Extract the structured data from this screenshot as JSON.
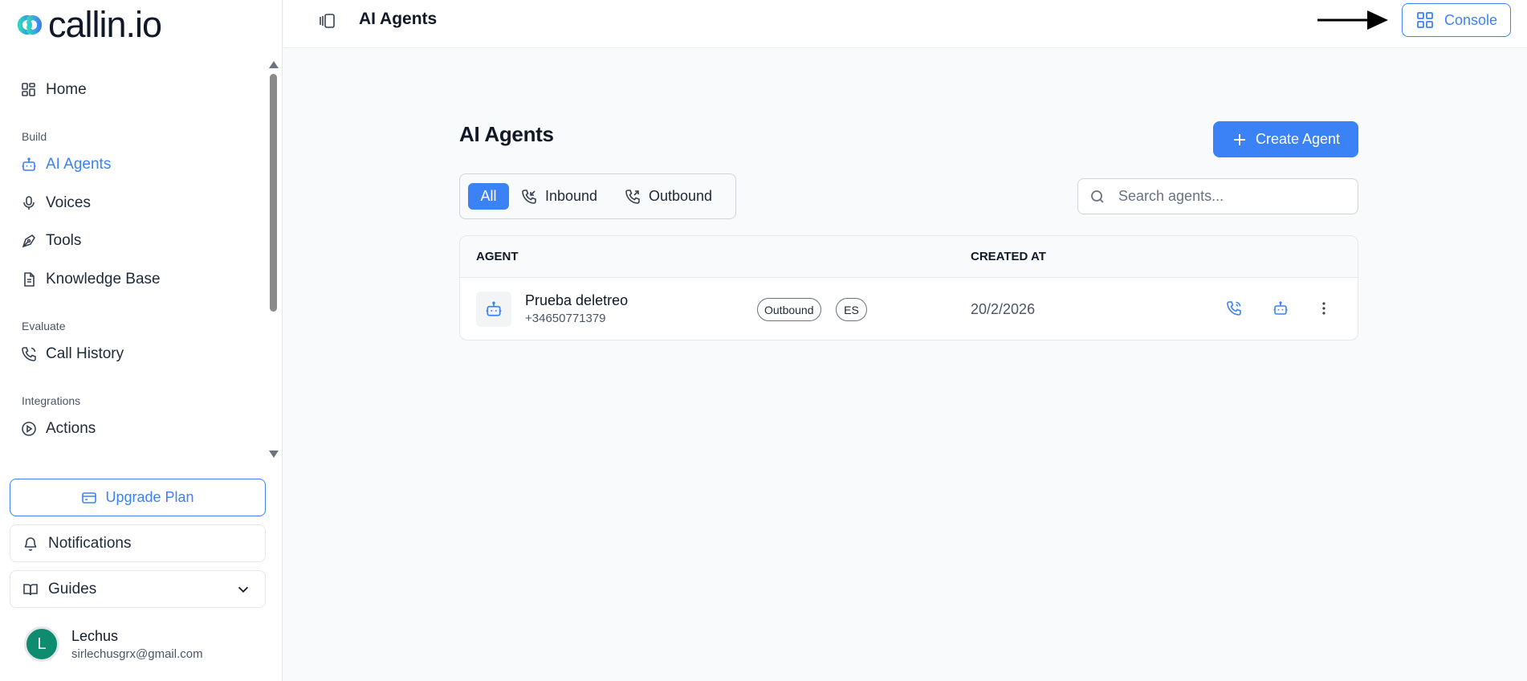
{
  "app": {
    "logo_text": "callin.io"
  },
  "sidebar": {
    "home": "Home",
    "sections": {
      "build": "Build",
      "evaluate": "Evaluate",
      "integrations": "Integrations"
    },
    "items": {
      "ai_agents": "AI Agents",
      "voices": "Voices",
      "tools": "Tools",
      "knowledge_base": "Knowledge Base",
      "call_history": "Call History",
      "actions": "Actions"
    },
    "upgrade_label": "Upgrade Plan",
    "notifications_label": "Notifications",
    "guides_label": "Guides",
    "user": {
      "initial": "L",
      "name": "Lechus",
      "email": "sirlechusgrx@gmail.com"
    }
  },
  "header": {
    "title": "AI Agents",
    "console_label": "Console"
  },
  "main": {
    "title": "AI Agents",
    "create_label": "Create Agent",
    "filters": {
      "all": "All",
      "inbound": "Inbound",
      "outbound": "Outbound"
    },
    "search_placeholder": "Search agents...",
    "table": {
      "col_agent": "AGENT",
      "col_created": "CREATED AT",
      "rows": [
        {
          "name": "Prueba deletreo",
          "phone": "+34650771379",
          "direction_badge": "Outbound",
          "language_badge": "ES",
          "created_at": "20/2/2026"
        }
      ]
    }
  },
  "colors": {
    "accent": "#3b82f6",
    "avatar": "#0d8c6f"
  }
}
